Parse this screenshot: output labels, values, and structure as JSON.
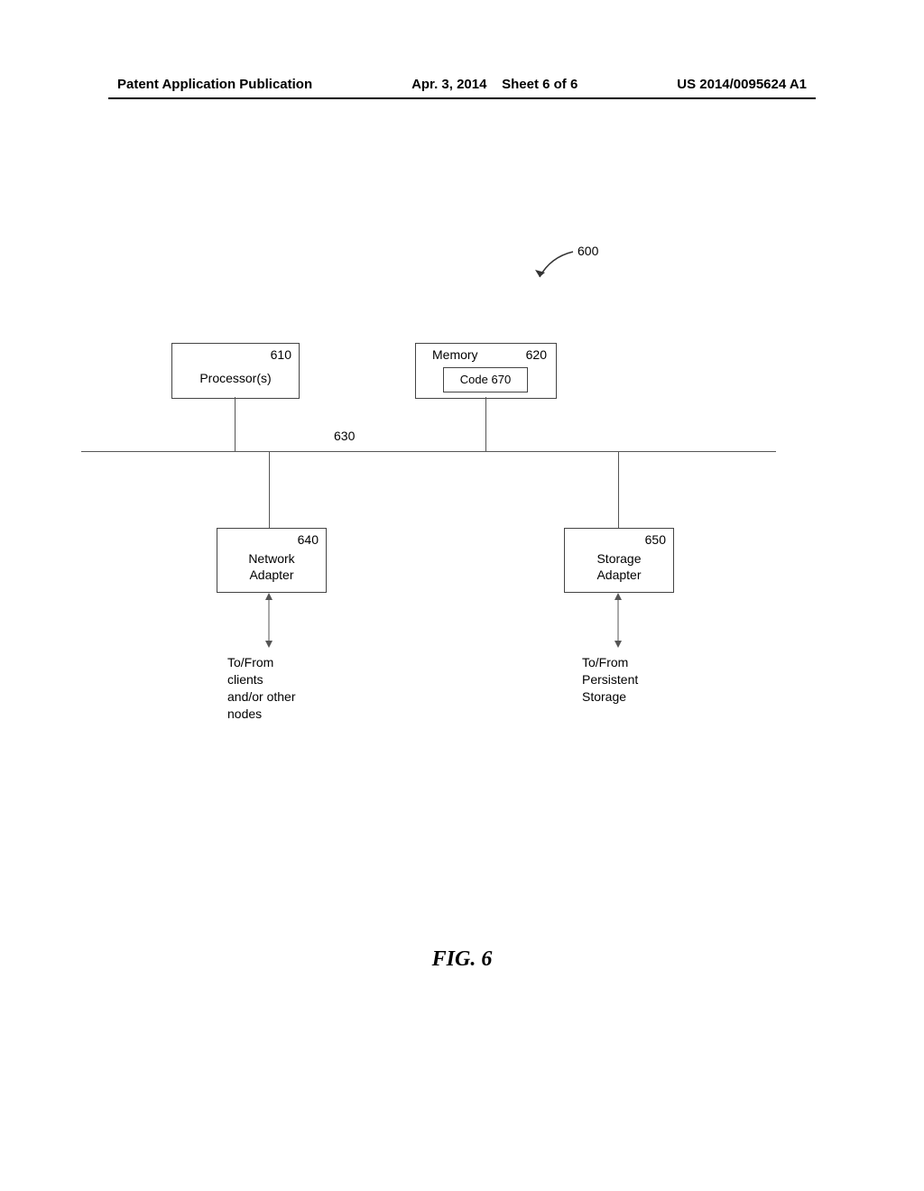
{
  "header": {
    "left": "Patent Application Publication",
    "center_date": "Apr. 3, 2014",
    "center_sheet": "Sheet 6 of 6",
    "right": "US 2014/0095624 A1"
  },
  "diagram": {
    "system_ref": "600",
    "processor": {
      "ref": "610",
      "label": "Processor(s)"
    },
    "memory": {
      "ref": "620",
      "label": "Memory",
      "code_ref": "670",
      "code_label": "Code"
    },
    "bus_ref": "630",
    "network": {
      "ref": "640",
      "label1": "Network",
      "label2": "Adapter",
      "note1": "To/From",
      "note2": "clients",
      "note3": "and/or other",
      "note4": "nodes"
    },
    "storage": {
      "ref": "650",
      "label1": "Storage",
      "label2": "Adapter",
      "note1": "To/From",
      "note2": "Persistent",
      "note3": "Storage"
    }
  },
  "figure_caption": "FIG. 6"
}
